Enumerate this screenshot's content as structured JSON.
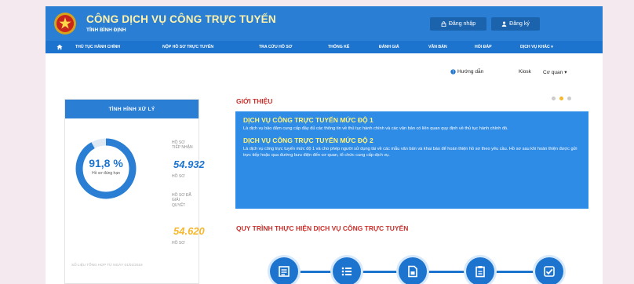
{
  "header": {
    "title": "CÔNG DỊCH VỤ CÔNG TRỰC TUYẾN",
    "subtitle": "TỈNH BÌNH ĐỊNH",
    "login_label": "Đăng nhập",
    "register_label": "Đăng ký",
    "colors": {
      "primary": "#2a7fd4",
      "nav": "#1d74cf",
      "title": "#fff2a8"
    }
  },
  "nav": {
    "items": [
      "THỦ TỤC HÀNH CHÍNH",
      "NỘP HỒ SƠ TRỰC TUYẾN",
      "TRA CỨU HỒ SƠ",
      "THỐNG KÊ",
      "ĐÁNH GIÁ",
      "VĂN BẢN",
      "HỎI ĐÁP",
      "DỊCH VỤ KHÁC"
    ]
  },
  "toolbar": {
    "guide_label": "Hướng dẫn",
    "kiosk_label": "Kiosk",
    "agency_label": "Cơ quan"
  },
  "stats": {
    "panel_title": "TÌNH HÌNH XỬ LÝ",
    "percent_text": "91,8 %",
    "percent_value": 91.8,
    "percent_label": "Hồ sơ đúng hạn",
    "received_label_1": "HỒ SƠ",
    "received_label_2": "TIẾP NHẬN",
    "received_count": "54.932",
    "received_unit": "HỒ SƠ",
    "resolved_label_1": "HỒ SƠ ĐÃ",
    "resolved_label_2": "GIẢI",
    "resolved_label_3": "QUYẾT",
    "resolved_count": "54.620",
    "resolved_unit": "HỒ SƠ",
    "note": "SỐ LIỆU TỔNG HỢP TỪ NGÀY 01/01/2019"
  },
  "intro": {
    "heading": "GIỚI THIỆU",
    "level3_title": "DỊCH VỤ CÔNG TRỰC TUYẾN MỨC ĐỘ 1",
    "level3_text": "Là dịch vụ bảo đảm cung cấp đầy đủ các thông tin về thủ tục hành chính và các văn bản có liên quan quy định về thủ tục hành chính đó.",
    "level4_title": "DỊCH VỤ CÔNG TRỰC TUYẾN MỨC ĐỘ 2",
    "level4_text": "Là dịch vụ công trực tuyến mức độ 1 và cho phép người sử dụng tải về các mẫu văn bản và khai báo để hoàn thiện hồ sơ theo yêu cầu. Hồ sơ sau khi hoàn thiện được gửi trực tiếp hoặc qua đường bưu điện đến cơ quan, tổ chức cung cấp dịch vụ.",
    "slider_colors": [
      "#cccccc",
      "#f5b82e",
      "#cccccc"
    ]
  },
  "process": {
    "heading": "QUY TRÌNH THỰC HIỆN DỊCH VỤ CÔNG TRỰC TUYẾN",
    "steps": [
      "form-icon",
      "list-icon",
      "document-icon",
      "clipboard-icon",
      "check-icon"
    ]
  }
}
